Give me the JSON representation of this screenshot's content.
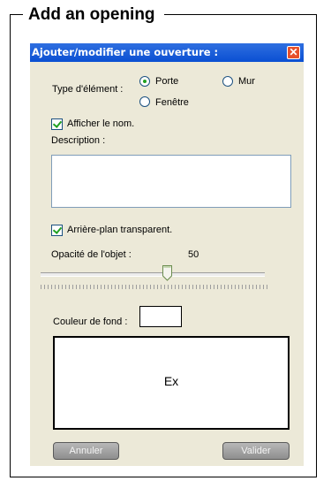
{
  "frame": {
    "title": "Add an opening"
  },
  "dialog": {
    "title": "Ajouter/modifier une ouverture :",
    "element_type": {
      "label": "Type d'élément :",
      "options": [
        {
          "label": "Porte",
          "selected": true
        },
        {
          "label": "Mur",
          "selected": false
        },
        {
          "label": "Fenêtre",
          "selected": false
        }
      ]
    },
    "show_name": {
      "label": "Afficher le nom.",
      "checked": true
    },
    "description": {
      "label": "Description :",
      "value": ""
    },
    "transparent_bg": {
      "label": "Arrière-plan transparent.",
      "checked": true
    },
    "opacity": {
      "label": "Opacité de l'objet :",
      "value": "50"
    },
    "bg_color": {
      "label": "Couleur de fond :",
      "value": "#ffffff"
    },
    "preview_text": "Ex",
    "buttons": {
      "cancel": "Annuler",
      "ok": "Valider"
    }
  },
  "colors": {
    "titlebar": "#0a4fd2",
    "dialog_bg": "#ece9d8",
    "close_button": "#e7502b",
    "check_mark": "#21a121"
  }
}
